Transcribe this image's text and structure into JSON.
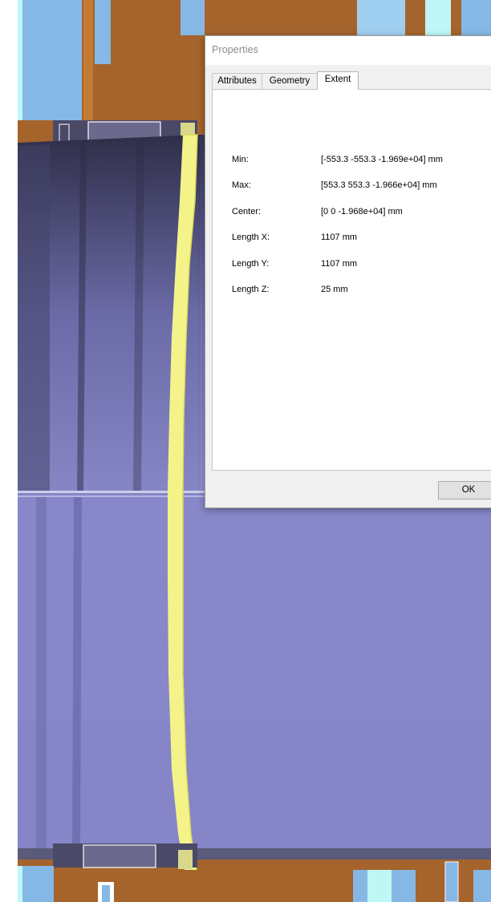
{
  "dialog": {
    "title": "Properties",
    "tabs": [
      {
        "label": "Attributes",
        "active": false
      },
      {
        "label": "Geometry",
        "active": false
      },
      {
        "label": "Extent",
        "active": true
      }
    ],
    "extent": [
      {
        "label": "Min:",
        "value": "[-553.3 -553.3 -1.969e+04] mm"
      },
      {
        "label": "Max:",
        "value": "[553.3 553.3 -1.966e+04] mm"
      },
      {
        "label": "Center:",
        "value": "[0 0 -1.968e+04] mm"
      },
      {
        "label": "Length X:",
        "value": "1107 mm"
      },
      {
        "label": "Length Y:",
        "value": "1107 mm"
      },
      {
        "label": "Length Z:",
        "value": "25 mm"
      }
    ],
    "ok_label": "OK"
  },
  "colors": {
    "background_brown": "#a5642c",
    "cylinder_top": "#3b3a56",
    "cylinder_bottom": "#8f8fd0",
    "highlight_yellow": "#f4f38a",
    "light_blue": "#86b8e6",
    "cyan": "#bff7f7"
  }
}
